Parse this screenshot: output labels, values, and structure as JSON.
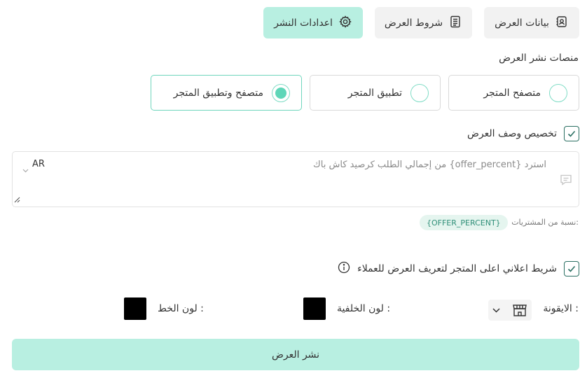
{
  "tabs": [
    {
      "label": "بيانات العرض",
      "icon": "offer-data-icon"
    },
    {
      "label": "شروط العرض",
      "icon": "terms-document-icon"
    },
    {
      "label": "اعدادات النشر",
      "icon": "settings-gear-icon",
      "active": true
    }
  ],
  "platforms": {
    "title": "منصات نشر العرض",
    "options": [
      {
        "label": "متصفح المتجر",
        "selected": false
      },
      {
        "label": "تطبيق المتجر",
        "selected": false
      },
      {
        "label": "متصفح وتطبيق المتجر",
        "selected": true
      }
    ]
  },
  "custom_description": {
    "label": "تخصيص وصف العرض",
    "checked": true,
    "placeholder": "استرد {offer_percent} من إجمالي الطلب كرصيد كاش باك",
    "language": "AR",
    "hint": "نسبة من المشتريات:",
    "variable_chip": "{OFFER_PERCENT}"
  },
  "ad_bar": {
    "label": "شريط اعلاني اعلى المتجر لتعريف العرض للعملاء",
    "checked": true
  },
  "style": {
    "icon_label": "الايقونة :",
    "background_color_label": "لون الخلفية :",
    "font_color_label": "لون الخط :",
    "background_color": "#000000",
    "font_color": "#000000"
  },
  "publish_button": "نشر العرض",
  "colors": {
    "accent": "#b8efe1",
    "radio_accent": "#5fd6b8",
    "check_color": "#2a6f62"
  }
}
